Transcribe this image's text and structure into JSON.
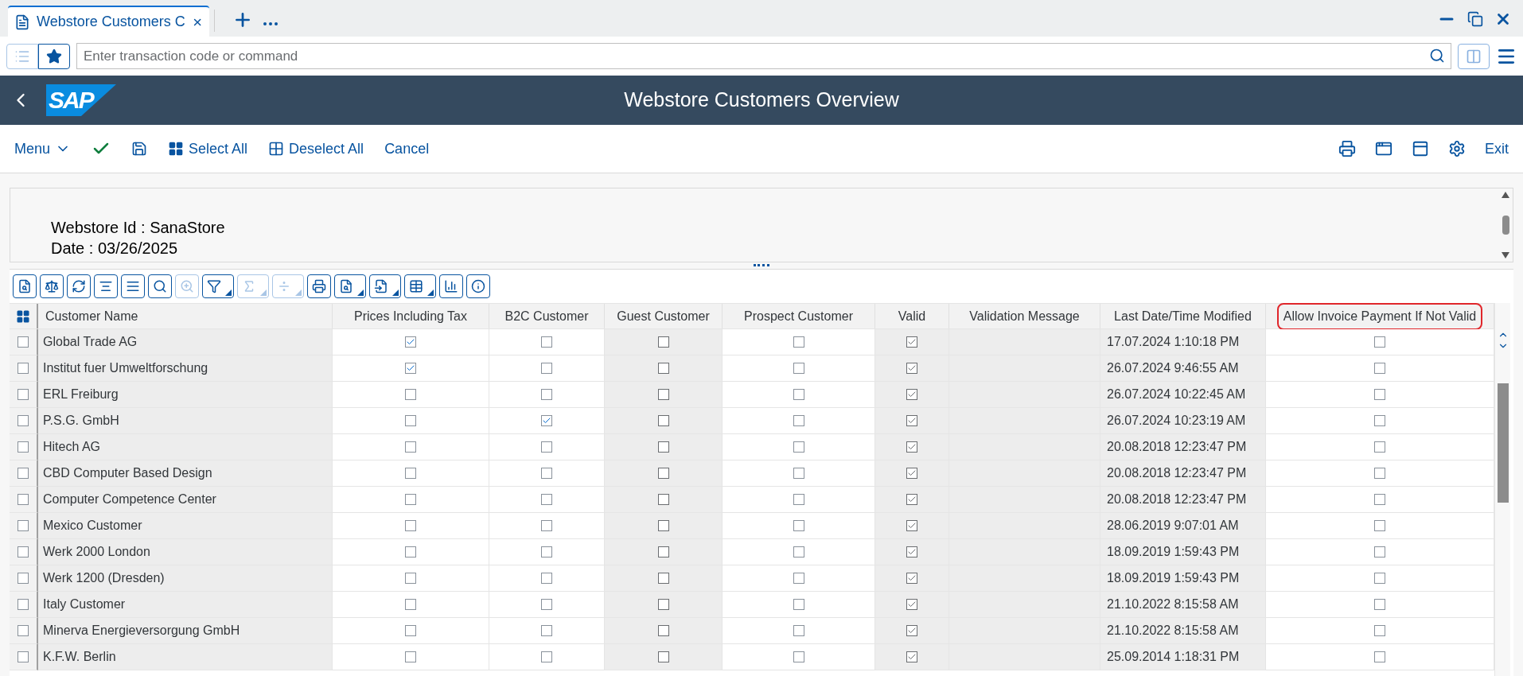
{
  "tab": {
    "title": "Webstore Customers C",
    "selected": true
  },
  "command_field": {
    "placeholder": "Enter transaction code or command"
  },
  "shell": {
    "logo": "SAP",
    "title": "Webstore Customers Overview"
  },
  "toolbar": {
    "menu": "Menu",
    "select_all": "Select All",
    "deselect_all": "Deselect All",
    "cancel": "Cancel",
    "exit": "Exit"
  },
  "info": {
    "webstore_id": "Webstore Id : SanaStore",
    "date": "Date : 03/26/2025"
  },
  "alv_toolbar": [
    {
      "disabled": false,
      "menu": false
    },
    {
      "disabled": false,
      "menu": false
    },
    {
      "disabled": false,
      "menu": false
    },
    {
      "disabled": false,
      "menu": false
    },
    {
      "disabled": false,
      "menu": false
    },
    {
      "disabled": false,
      "menu": false
    },
    {
      "disabled": true,
      "menu": false
    },
    {
      "disabled": false,
      "menu": true
    },
    {
      "disabled": true,
      "menu": true
    },
    {
      "disabled": true,
      "menu": true
    },
    {
      "disabled": false,
      "menu": false
    },
    {
      "disabled": false,
      "menu": true
    },
    {
      "disabled": false,
      "menu": true
    },
    {
      "disabled": false,
      "menu": true
    },
    {
      "disabled": false,
      "menu": false
    },
    {
      "disabled": false,
      "menu": false
    }
  ],
  "table": {
    "columns": [
      {
        "label": "Customer Name",
        "readonly": true,
        "highlighted": false
      },
      {
        "label": "Prices Including Tax",
        "readonly": false,
        "highlighted": false
      },
      {
        "label": "B2C Customer",
        "readonly": false,
        "highlighted": false
      },
      {
        "label": "Guest Customer",
        "readonly": true,
        "highlighted": false
      },
      {
        "label": "Prospect Customer",
        "readonly": false,
        "highlighted": false
      },
      {
        "label": "Valid",
        "readonly": true,
        "highlighted": false
      },
      {
        "label": "Validation Message",
        "readonly": true,
        "highlighted": false
      },
      {
        "label": "Last Date/Time Modified",
        "readonly": true,
        "highlighted": false
      },
      {
        "label": "Allow Invoice Payment If Not Valid",
        "readonly": false,
        "highlighted": true
      }
    ],
    "rows": [
      {
        "selected": false,
        "name": "Global Trade AG",
        "flags": [
          true,
          false,
          false,
          false,
          true
        ],
        "last_modified": "17.07.2024 1:10:18 PM",
        "allow_invoice": false
      },
      {
        "selected": false,
        "name": "Institut fuer Umweltforschung",
        "flags": [
          true,
          false,
          false,
          false,
          true
        ],
        "last_modified": "26.07.2024 9:46:55 AM",
        "allow_invoice": false
      },
      {
        "selected": false,
        "name": "ERL Freiburg",
        "flags": [
          false,
          false,
          false,
          false,
          true
        ],
        "last_modified": "26.07.2024 10:22:45 AM",
        "allow_invoice": false
      },
      {
        "selected": false,
        "name": "P.S.G. GmbH",
        "flags": [
          false,
          true,
          false,
          false,
          true
        ],
        "last_modified": "26.07.2024 10:23:19 AM",
        "allow_invoice": false
      },
      {
        "selected": false,
        "name": "Hitech AG",
        "flags": [
          false,
          false,
          false,
          false,
          true
        ],
        "last_modified": "20.08.2018 12:23:47 PM",
        "allow_invoice": false
      },
      {
        "selected": false,
        "name": "CBD Computer Based Design",
        "flags": [
          false,
          false,
          false,
          false,
          true
        ],
        "last_modified": "20.08.2018 12:23:47 PM",
        "allow_invoice": false
      },
      {
        "selected": false,
        "name": "Computer Competence Center",
        "flags": [
          false,
          false,
          false,
          false,
          true
        ],
        "last_modified": "20.08.2018 12:23:47 PM",
        "allow_invoice": false
      },
      {
        "selected": false,
        "name": "Mexico Customer",
        "flags": [
          false,
          false,
          false,
          false,
          true
        ],
        "last_modified": "28.06.2019 9:07:01 AM",
        "allow_invoice": false
      },
      {
        "selected": false,
        "name": "Werk 2000 London",
        "flags": [
          false,
          false,
          false,
          false,
          true
        ],
        "last_modified": "18.09.2019 1:59:43 PM",
        "allow_invoice": false
      },
      {
        "selected": false,
        "name": "Werk 1200 (Dresden)",
        "flags": [
          false,
          false,
          false,
          false,
          true
        ],
        "last_modified": "18.09.2019 1:59:43 PM",
        "allow_invoice": false
      },
      {
        "selected": false,
        "name": "Italy Customer",
        "flags": [
          false,
          false,
          false,
          false,
          true
        ],
        "last_modified": "21.10.2022 8:15:58 AM",
        "allow_invoice": false
      },
      {
        "selected": false,
        "name": "Minerva Energieversorgung GmbH",
        "flags": [
          false,
          false,
          false,
          false,
          true
        ],
        "last_modified": "21.10.2022 8:15:58 AM",
        "allow_invoice": false
      },
      {
        "selected": false,
        "name": "K.F.W. Berlin",
        "flags": [
          false,
          false,
          false,
          false,
          true
        ],
        "last_modified": "25.09.2014 1:18:31 PM",
        "allow_invoice": false
      }
    ]
  }
}
